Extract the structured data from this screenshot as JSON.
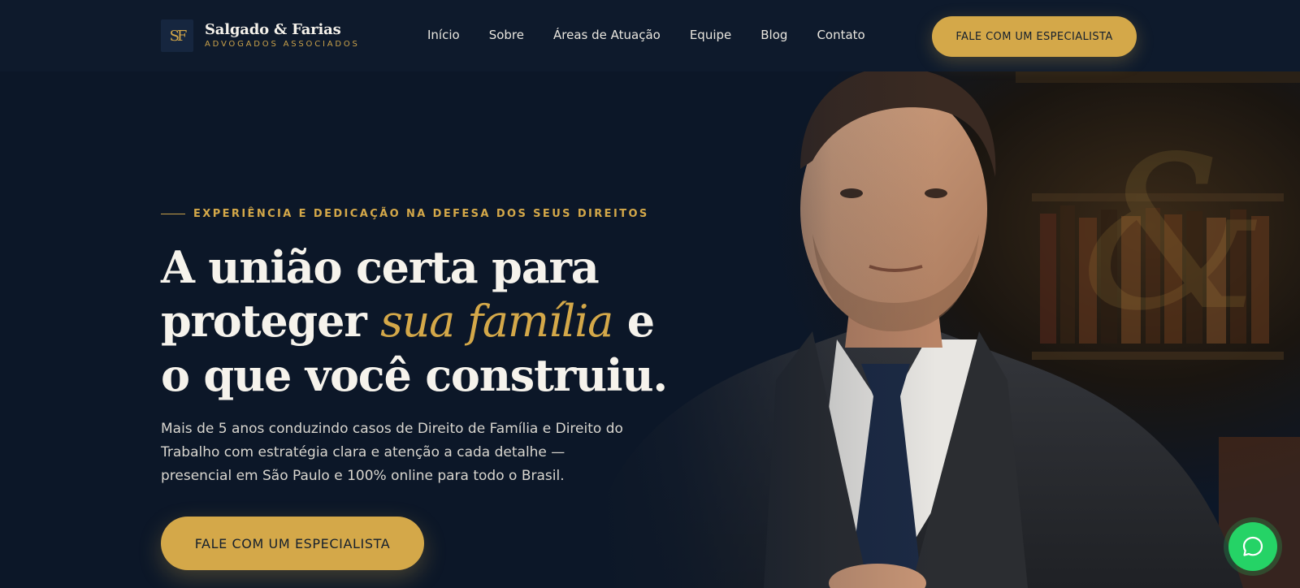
{
  "brand": {
    "logo_glyph": "SF",
    "name": "Salgado & Farias",
    "tagline": "ADVOGADOS ASSOCIADOS"
  },
  "nav": {
    "items": [
      {
        "label": "Início"
      },
      {
        "label": "Sobre"
      },
      {
        "label": "Áreas de Atuação"
      },
      {
        "label": "Equipe"
      },
      {
        "label": "Blog"
      },
      {
        "label": "Contato"
      }
    ]
  },
  "header": {
    "cta_label": "FALE COM UM ESPECIALISTA"
  },
  "hero": {
    "eyebrow": "EXPERIÊNCIA E DEDICAÇÃO NA DEFESA DOS SEUS DIREITOS",
    "headline_part1": "A união certa para proteger ",
    "headline_accent": "sua família",
    "headline_part2": " e o que você construiu.",
    "lead": "Mais de 5 anos conduzindo casos de Direito de Família e Direito do Trabalho com estratégia clara e atenção a cada detalhe — presencial em São Paulo e 100% online para todo o Brasil.",
    "cta_label": "FALE COM UM ESPECIALISTA"
  },
  "floating": {
    "whatsapp_icon": "whatsapp-icon"
  },
  "colors": {
    "background": "#0d1a2b",
    "accent_gold": "#d4a849",
    "text_light": "#f6f3ec",
    "whatsapp_green": "#25d366"
  }
}
